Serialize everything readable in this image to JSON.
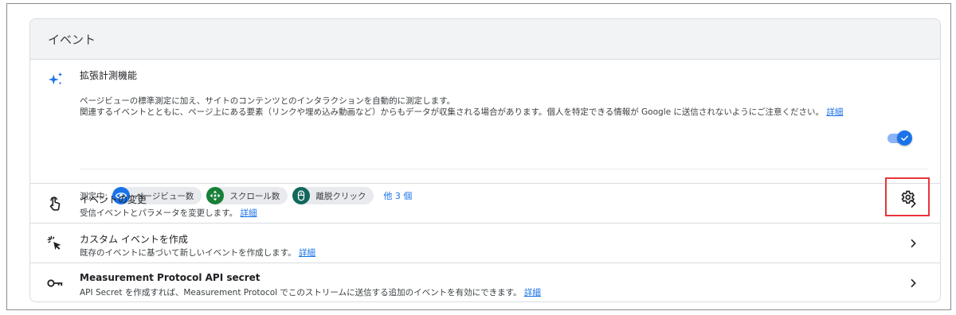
{
  "card": {
    "title": "イベント"
  },
  "enhanced": {
    "title": "拡張計測機能",
    "desc_line1": "ページビューの標準測定に加え、サイトのコンテンツとのインタラクションを自動的に測定します。",
    "desc_line2": "関連するイベントとともに、ページ上にある要素（リンクや埋め込み動画など）からもデータが収集される場合があります。個人を特定できる情報が Google に送信されないようにご注意ください。",
    "desc_link": "詳細",
    "toggle_on": true,
    "measuring_label": "測定中:",
    "chips": [
      {
        "label": "ページビュー数",
        "icon": "eye-icon",
        "color": "#1a73e8"
      },
      {
        "label": "スクロール数",
        "icon": "scroll-arrows-icon",
        "color": "#188038"
      },
      {
        "label": "離脱クリック",
        "icon": "mouse-icon",
        "color": "#12685c"
      }
    ],
    "more_label": "他 3 個",
    "settings_icon": "gear-icon"
  },
  "rows": [
    {
      "title": "イベントの変更",
      "sub": "受信イベントとパラメータを変更します。",
      "link": "詳細",
      "icon": "touch-hand-icon"
    },
    {
      "title": "カスタム イベントを作成",
      "sub": "既存のイベントに基づいて新しいイベントを作成します。",
      "link": "詳細",
      "icon": "sparkle-click-icon"
    },
    {
      "title": "Measurement Protocol API secret",
      "sub": "API Secret を作成すれば、Measurement Protocol でこのストリームに送信する追加のイベントを有効にできます。",
      "link": "詳細",
      "icon": "key-icon"
    }
  ],
  "colors": {
    "accent": "#1a73e8",
    "highlight_box": "#e8343a"
  }
}
